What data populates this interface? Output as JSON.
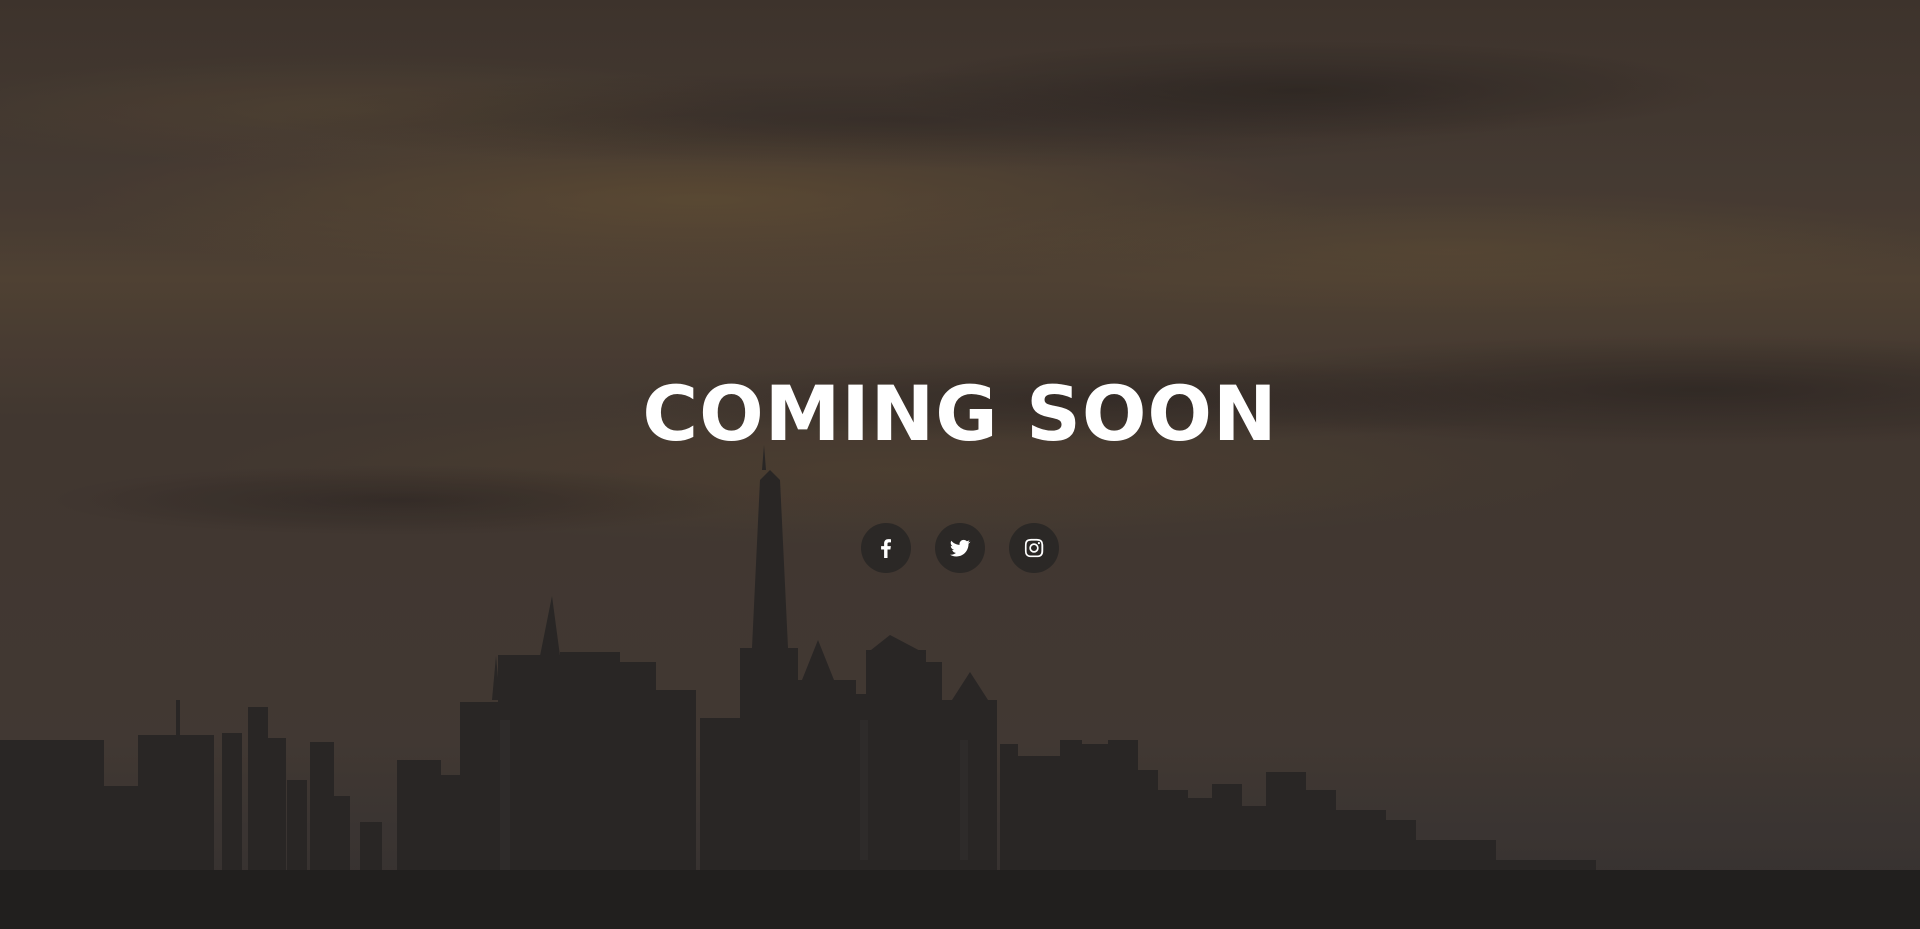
{
  "page": {
    "title": "COMING SOON"
  },
  "social": [
    {
      "icon": "facebook-icon"
    },
    {
      "icon": "twitter-icon"
    },
    {
      "icon": "instagram-icon"
    }
  ],
  "colors": {
    "text": "#ffffff",
    "button_bg": "#2b2826",
    "sky": "#4a3f38"
  }
}
